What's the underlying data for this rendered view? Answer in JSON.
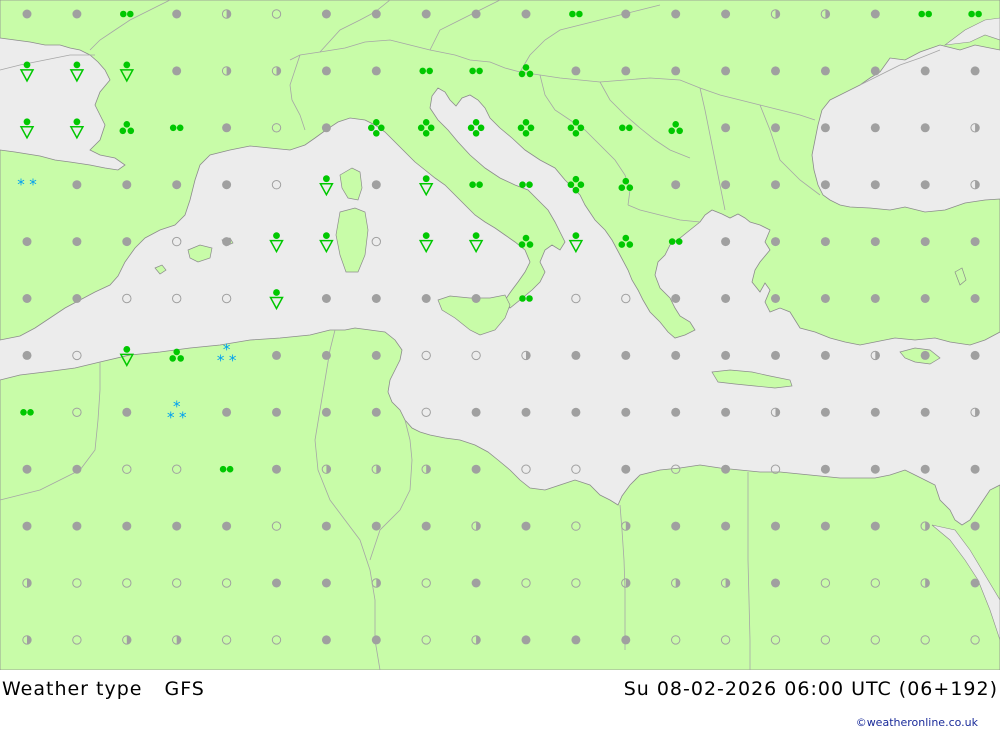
{
  "title": {
    "product": "Weather type",
    "model": "GFS",
    "valid_time": "Su 08-02-2026 06:00 UTC (06+192)"
  },
  "credit": "©weatheronline.co.uk",
  "colors": {
    "land": "#c8fca8",
    "sea": "#ececec",
    "border": "#a6a6a6",
    "coast": "#8c8c8c",
    "no_precip": "#a0a0a0",
    "rain": "#00c800",
    "snow": "#00a0f0"
  },
  "legend_symbols": {
    "filled-dot": "overcast / no precipitation",
    "open-circle": "clear",
    "half-circle": "partly cloudy",
    "double-dot": "light rain",
    "triple-dot": "rain",
    "quad-dot": "heavy rain",
    "shower": "rain shower",
    "star": "snow",
    "snow-shower": "snow shower"
  },
  "grid": {
    "rows": [
      [
        "dot",
        "dot",
        "rain2",
        "dot",
        "half",
        "open",
        "dot",
        "dot",
        "dot",
        "dot",
        "dot",
        "rain2",
        "dot",
        "dot",
        "dot",
        "half",
        "half",
        "dot",
        "rain2",
        "rain2"
      ],
      [
        "shower",
        "shower",
        "shower",
        "dot",
        "half",
        "half",
        "dot",
        "dot",
        "rain2",
        "rain2",
        "rain3",
        "dot",
        "dot",
        "dot",
        "dot",
        "dot",
        "dot",
        "dot",
        "dot",
        "dot"
      ],
      [
        "shower",
        "shower",
        "rain3",
        "rain2",
        "dot",
        "open",
        "dot",
        "rain4",
        "rain4",
        "rain4",
        "rain4",
        "rain4",
        "rain2",
        "rain3",
        "dot",
        "dot",
        "dot",
        "dot",
        "dot",
        "half"
      ],
      [
        "snow2",
        "dot",
        "dot",
        "dot",
        "dot",
        "open",
        "shower",
        "dot",
        "shower",
        "rain2",
        "rain2",
        "rain4",
        "rain3",
        "dot",
        "dot",
        "dot",
        "dot",
        "dot",
        "dot",
        "half"
      ],
      [
        "dot",
        "dot",
        "dot",
        "open",
        "dot",
        "shower",
        "shower",
        "open",
        "shower",
        "shower",
        "rain3",
        "shower",
        "rain3",
        "rain2",
        "dot",
        "dot",
        "dot",
        "dot",
        "dot",
        "dot"
      ],
      [
        "dot",
        "dot",
        "open",
        "open",
        "open",
        "shower",
        "dot",
        "dot",
        "dot",
        "dot",
        "rain2",
        "open",
        "open",
        "dot",
        "dot",
        "dot",
        "dot",
        "dot",
        "dot",
        "dot"
      ],
      [
        "dot",
        "open",
        "shower",
        "rain3",
        "snow3",
        "dot",
        "dot",
        "dot",
        "open",
        "open",
        "half",
        "dot",
        "dot",
        "dot",
        "dot",
        "dot",
        "dot",
        "half",
        "dot",
        "dot"
      ],
      [
        "rain2",
        "open",
        "dot",
        "snow3",
        "dot",
        "dot",
        "dot",
        "dot",
        "open",
        "dot",
        "dot",
        "dot",
        "dot",
        "dot",
        "dot",
        "half",
        "dot",
        "dot",
        "dot",
        "half"
      ],
      [
        "dot",
        "dot",
        "open",
        "open",
        "rain2",
        "dot",
        "half",
        "half",
        "half",
        "dot",
        "open",
        "open",
        "dot",
        "open",
        "dot",
        "open",
        "dot",
        "dot",
        "dot",
        "dot"
      ],
      [
        "dot",
        "dot",
        "dot",
        "dot",
        "dot",
        "open",
        "dot",
        "dot",
        "dot",
        "half",
        "dot",
        "open",
        "half",
        "dot",
        "dot",
        "dot",
        "dot",
        "dot",
        "half",
        "dot"
      ],
      [
        "half",
        "open",
        "open",
        "open",
        "open",
        "dot",
        "dot",
        "half",
        "open",
        "dot",
        "open",
        "open",
        "half",
        "half",
        "half",
        "dot",
        "open",
        "open",
        "half",
        "dot"
      ],
      [
        "half",
        "open",
        "half",
        "half",
        "open",
        "open",
        "dot",
        "dot",
        "open",
        "half",
        "dot",
        "dot",
        "dot",
        "open",
        "open",
        "open",
        "open",
        "open",
        "open",
        "open"
      ]
    ]
  }
}
